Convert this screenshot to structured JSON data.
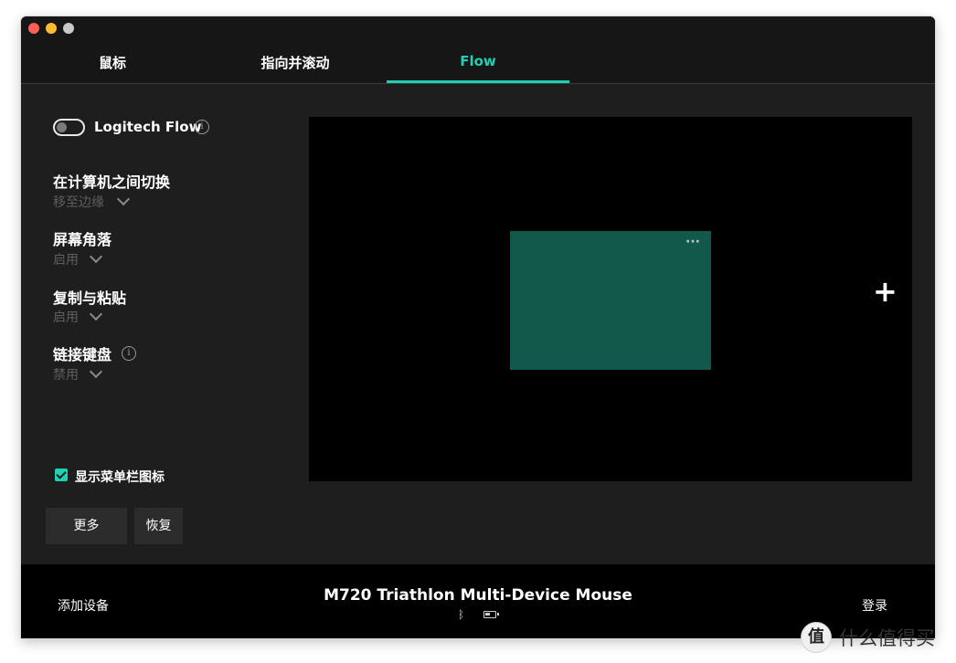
{
  "tabs": [
    {
      "label": "鼠标"
    },
    {
      "label": "指向并滚动"
    },
    {
      "label": "Flow",
      "active": true
    }
  ],
  "accent_color": "#1fd1b2",
  "flow": {
    "toggle_label": "Logitech Flow",
    "toggle_on": false,
    "info_icon": "info-icon"
  },
  "settings": [
    {
      "title": "在计算机之间切换",
      "value": "移至边缘"
    },
    {
      "title": "屏幕角落",
      "value": "启用"
    },
    {
      "title": "复制与粘贴",
      "value": "启用"
    },
    {
      "title": "链接键盘",
      "value": "禁用"
    }
  ],
  "show_menubar_icon": {
    "label": "显示菜单栏图标",
    "checked": true
  },
  "buttons": {
    "more": "更多",
    "restore": "恢复"
  },
  "canvas": {
    "screen_menu": "···",
    "add_symbol": "+",
    "screen_color": "#12594b"
  },
  "footer": {
    "add_device": "添加设备",
    "device_name": "M720 Triathlon Multi-Device Mouse",
    "bluetooth_icon": "ᛒ",
    "battery_level": 0.6,
    "login": "登录"
  },
  "watermark": {
    "logo": "值",
    "text": "什么值得买"
  }
}
